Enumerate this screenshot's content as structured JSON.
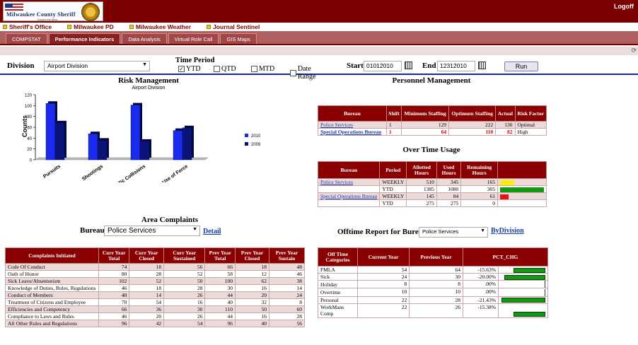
{
  "header": {
    "org_line1": "Milwaukee County Sheriff",
    "org_line2": "Expect the Best",
    "logoff": "Logoff"
  },
  "links": [
    "Sheriff's Office",
    "Milwaukee PD",
    "Milwaukee Weather",
    "Journal Sentinel"
  ],
  "tabs": [
    {
      "label": "COMPSTAT",
      "active": false
    },
    {
      "label": "Performance Indicators",
      "active": true
    },
    {
      "label": "Data Analysis",
      "active": false
    },
    {
      "label": "Virtual Role Call",
      "active": false
    },
    {
      "label": "GIS Maps",
      "active": false
    }
  ],
  "filters": {
    "division_label": "Division",
    "division_value": "Airport Division",
    "time_period_label": "Time Period",
    "periods": [
      {
        "label": "YTD",
        "checked": true
      },
      {
        "label": "QTD",
        "checked": false
      },
      {
        "label": "MTD",
        "checked": false
      },
      {
        "label": "Date Range",
        "checked": false
      }
    ],
    "start_label": "Start",
    "start_value": "01012010",
    "end_label": "End",
    "end_value": "12312010",
    "run_label": "Run"
  },
  "risk": {
    "title": "Risk Management",
    "subtitle": "Airport Division"
  },
  "chart_data": {
    "type": "bar",
    "ylabel": "Counts",
    "ylim": [
      0,
      120
    ],
    "yticks": [
      0,
      20,
      40,
      60,
      80,
      100,
      120
    ],
    "categories": [
      "Pursuits",
      "Shootings",
      "Traffic Collisions",
      "Use of Force"
    ],
    "series": [
      {
        "name": "2010",
        "color": "#1a2aee",
        "values": [
          104,
          48,
          101,
          54
        ]
      },
      {
        "name": "2009",
        "color": "#0a1478",
        "values": [
          68,
          36,
          34,
          59
        ]
      }
    ]
  },
  "personnel": {
    "title": "Personnel Management",
    "headers": [
      "Bureau",
      "Shift",
      "Minimum Staffing",
      "Optimum Staffing",
      "Actual",
      "Risk Factor"
    ],
    "rows": [
      {
        "bureau": "Police Services",
        "shift": "1",
        "min": "129",
        "opt": "222",
        "actual": "130",
        "risk": "Optimal"
      },
      {
        "bureau": "Special Operations Bureau",
        "shift": "1",
        "min": "64",
        "opt": "110",
        "actual": "82",
        "risk": "High"
      }
    ]
  },
  "overtime": {
    "title": "Over Time Usage",
    "headers": [
      "Bureau",
      "Period",
      "Allotted Hours",
      "Used Hours",
      "Remaining Hours"
    ],
    "rows": [
      {
        "bureau": "Police Services",
        "period": "WEEKLY",
        "allotted": "510",
        "used": "345",
        "remaining": "165",
        "bar_color": "#ffee00",
        "bar_fraction": 0.32
      },
      {
        "bureau": "",
        "period": "YTD",
        "allotted": "1385",
        "used": "1080",
        "remaining": "305",
        "bar_color": "#119911",
        "bar_fraction": 1.0
      },
      {
        "bureau": "Special Operations Bureau",
        "period": "WEEKLY",
        "allotted": "145",
        "used": "84",
        "remaining": "61",
        "bar_color": "#ee1111",
        "bar_fraction": 0.2
      },
      {
        "bureau": "",
        "period": "YTD",
        "allotted": "275",
        "used": "275",
        "remaining": "0",
        "bar_color": "#119911",
        "bar_fraction": 0
      }
    ]
  },
  "complaints": {
    "title": "Area Complaints",
    "bureau_label": "Bureau:",
    "bureau_value": "Police Services",
    "detail_link": "Detail",
    "headers": [
      "Complaints Initiated",
      "Curr Year Total",
      "Curr Year Closed",
      "Curr Year Sustained",
      "Prev Year Total",
      "Prev Year Closed",
      "Prev Year Sustain"
    ],
    "rows": [
      [
        "Code Of Conduct",
        "74",
        "18",
        "56",
        "66",
        "18",
        "48"
      ],
      [
        "Oath of Honor",
        "80",
        "28",
        "52",
        "58",
        "12",
        "46"
      ],
      [
        "Sick Leave/Absenteeism",
        "102",
        "52",
        "50",
        "100",
        "62",
        "38"
      ],
      [
        "Knowledge of Duties, Rules, Regulations",
        "46",
        "18",
        "28",
        "30",
        "16",
        "14"
      ],
      [
        "Conduct of Members",
        "40",
        "14",
        "26",
        "44",
        "20",
        "24"
      ],
      [
        "Treatment of Citizens and Employee",
        "70",
        "54",
        "16",
        "40",
        "32",
        "8"
      ],
      [
        "Efficiencies and Competency",
        "66",
        "36",
        "30",
        "110",
        "50",
        "60"
      ],
      [
        "Compliance to Laws and Rules",
        "46",
        "20",
        "26",
        "44",
        "16",
        "28"
      ],
      [
        "All Other Rules and Regulations",
        "96",
        "42",
        "54",
        "96",
        "40",
        "56"
      ]
    ]
  },
  "offtime": {
    "title": "Offtime Report for Bureau:",
    "bureau_value": "Police Services",
    "by_division_link": "ByDivision",
    "headers": [
      "Off Time Categories",
      "Current Year",
      "Previous Year",
      "PCT_CHG"
    ],
    "rows": [
      {
        "cat": "FMLA",
        "cur": "54",
        "prev": "64",
        "pct": "-15.63%",
        "frac": 0.73
      },
      {
        "cat": "Sick",
        "cur": "24",
        "prev": "30",
        "pct": "-20.00%",
        "frac": 0.93
      },
      {
        "cat": "Holiday",
        "cur": "8",
        "prev": "8",
        "pct": ".00%",
        "frac": 0
      },
      {
        "cat": "Overtime",
        "cur": "10",
        "prev": "10",
        "pct": ".00%",
        "frac": 0
      },
      {
        "cat": "Personal",
        "cur": "22",
        "prev": "28",
        "pct": "-21.43%",
        "frac": 1.0
      },
      {
        "cat": "WorkMans Comp",
        "cur": "22",
        "prev": "26",
        "pct": "-15.38%",
        "frac": 0.72
      }
    ]
  }
}
